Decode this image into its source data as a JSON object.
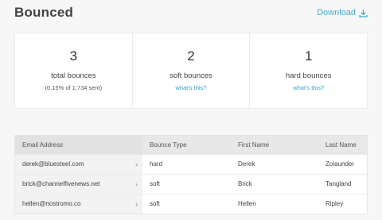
{
  "header": {
    "title": "Bounced",
    "download_label": "Download"
  },
  "stats": [
    {
      "value": "3",
      "label": "total bounces",
      "sub": "(0.15% of 1,734 sent)"
    },
    {
      "value": "2",
      "label": "soft bounces",
      "link": "what's this?"
    },
    {
      "value": "1",
      "label": "hard bounces",
      "link": "what's this?"
    }
  ],
  "table": {
    "columns": [
      "Email Address",
      "Bounce Type",
      "First Name",
      "Last Name"
    ],
    "rows": [
      {
        "email": "derek@bluesteel.com",
        "type": "hard",
        "first": "Derek",
        "last": "Zolaunder"
      },
      {
        "email": "brick@channelfivenews.net",
        "type": "soft",
        "first": "Brick",
        "last": "Tangland"
      },
      {
        "email": "hellen@nostromo.co",
        "type": "soft",
        "first": "Hellen",
        "last": "Ripley"
      }
    ]
  },
  "icons": {
    "download": "download-icon",
    "row_chevron": "chevron-right-icon"
  },
  "colors": {
    "accent": "#3cb0d6",
    "background": "#f7f7f7",
    "header_row": "#e8e8e8"
  }
}
